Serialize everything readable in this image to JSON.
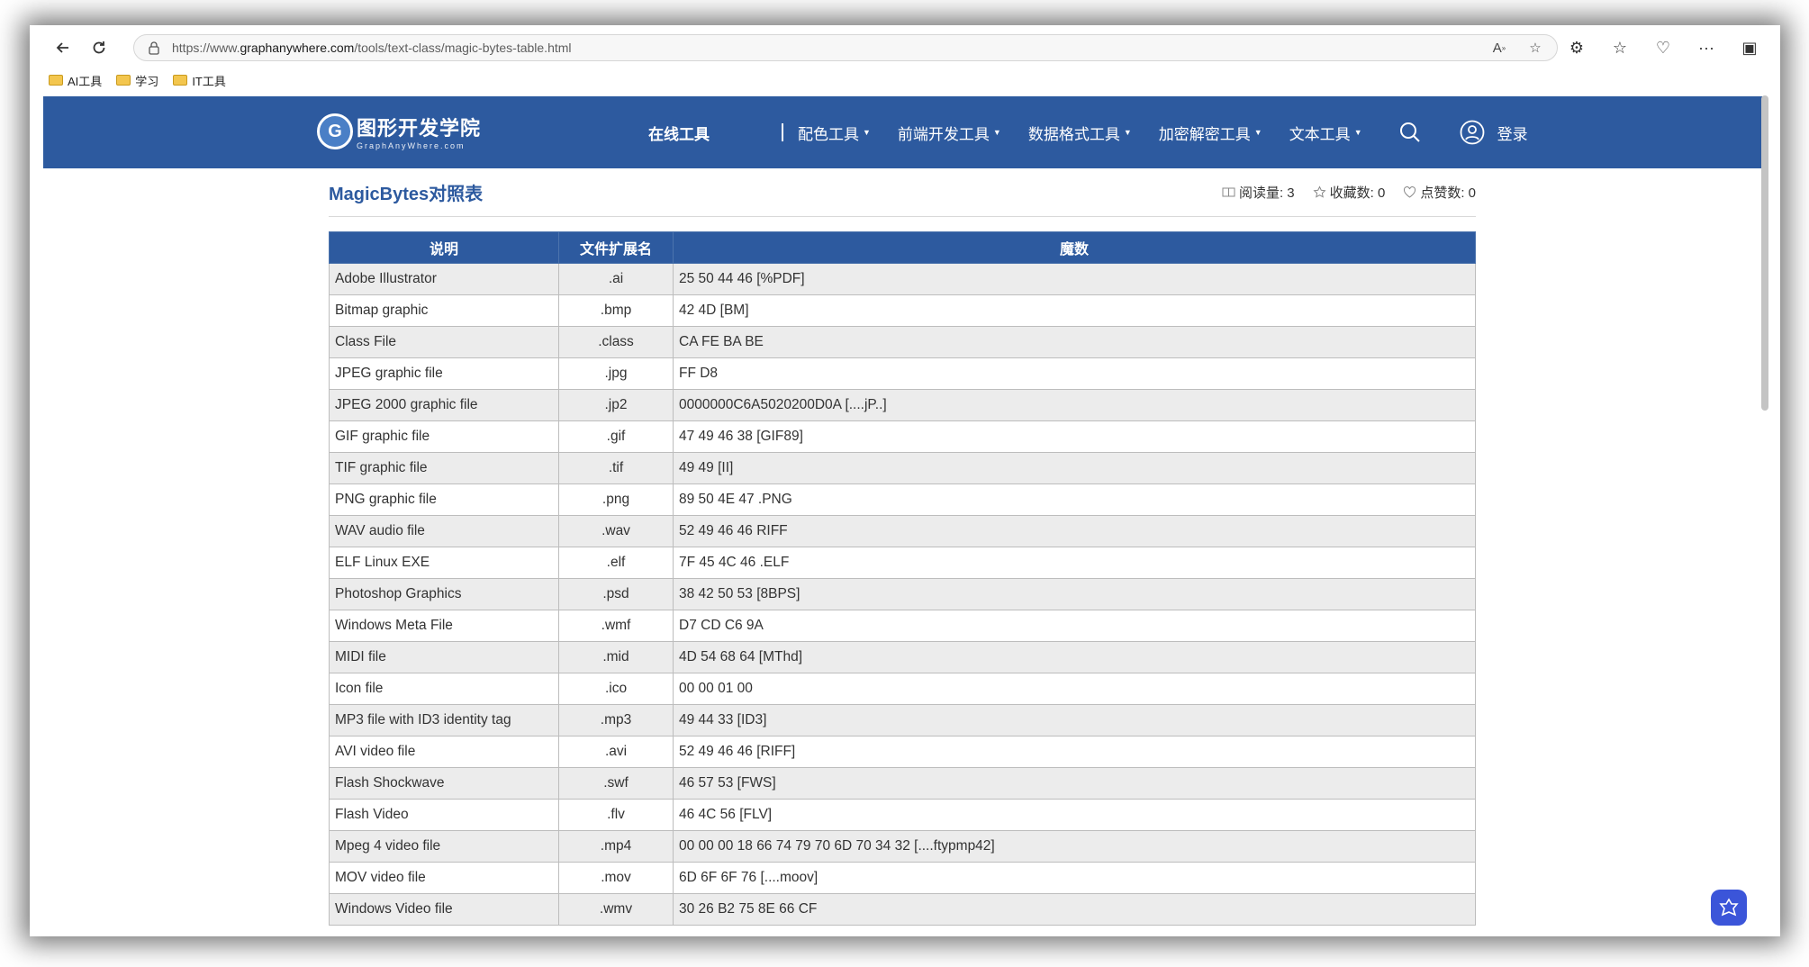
{
  "browser": {
    "url_prefix": "https://www.",
    "url_domain": "graphanywhere.com",
    "url_path": "/tools/text-class/magic-bytes-table.html"
  },
  "bookmarks": [
    {
      "label": "AI工具"
    },
    {
      "label": "学习"
    },
    {
      "label": "IT工具"
    }
  ],
  "site": {
    "logo_cn": "图形开发学院",
    "logo_en": "GraphAnyWhere.com",
    "nav_main": "在线工具",
    "nav_items": [
      "配色工具",
      "前端开发工具",
      "数据格式工具",
      "加密解密工具",
      "文本工具"
    ],
    "login": "登录"
  },
  "page": {
    "title": "MagicBytes对照表",
    "read_label": "阅读量: 3",
    "fav_label": "收藏数: 0",
    "like_label": "点赞数: 0"
  },
  "table": {
    "headers": [
      "说明",
      "文件扩展名",
      "魔数"
    ],
    "rows": [
      [
        "Adobe Illustrator",
        ".ai",
        "25 50 44 46 [%PDF]"
      ],
      [
        "Bitmap graphic",
        ".bmp",
        "42 4D [BM]"
      ],
      [
        "Class File",
        ".class",
        "CA FE BA BE"
      ],
      [
        "JPEG graphic file",
        ".jpg",
        "FF D8"
      ],
      [
        "JPEG 2000 graphic file",
        ".jp2",
        "0000000C6A5020200D0A [....jP..]"
      ],
      [
        "GIF graphic file",
        ".gif",
        "47 49 46 38 [GIF89]"
      ],
      [
        "TIF graphic file",
        ".tif",
        "49 49 [II]"
      ],
      [
        "PNG graphic file",
        ".png",
        "89 50 4E 47 .PNG"
      ],
      [
        "WAV audio file",
        ".wav",
        "52 49 46 46 RIFF"
      ],
      [
        "ELF Linux EXE",
        ".elf",
        "7F 45 4C 46 .ELF"
      ],
      [
        "Photoshop Graphics",
        ".psd",
        "38 42 50 53 [8BPS]"
      ],
      [
        "Windows Meta File",
        ".wmf",
        "D7 CD C6 9A"
      ],
      [
        "MIDI file",
        ".mid",
        "4D 54 68 64 [MThd]"
      ],
      [
        "Icon file",
        ".ico",
        "00 00 01 00"
      ],
      [
        "MP3 file with ID3 identity tag",
        ".mp3",
        "49 44 33 [ID3]"
      ],
      [
        "AVI video file",
        ".avi",
        "52 49 46 46 [RIFF]"
      ],
      [
        "Flash Shockwave",
        ".swf",
        "46 57 53 [FWS]"
      ],
      [
        "Flash Video",
        ".flv",
        "46 4C 56 [FLV]"
      ],
      [
        "Mpeg 4 video file",
        ".mp4",
        "00 00 00 18 66 74 79 70 6D 70 34 32 [....ftypmp42]"
      ],
      [
        "MOV video file",
        ".mov",
        "6D 6F 6F 76 [....moov]"
      ],
      [
        "Windows Video file",
        ".wmv",
        "30 26 B2 75 8E 66 CF"
      ]
    ]
  },
  "colors": {
    "header_blue": "#2d5a9f",
    "row_alt": "#ececec"
  }
}
